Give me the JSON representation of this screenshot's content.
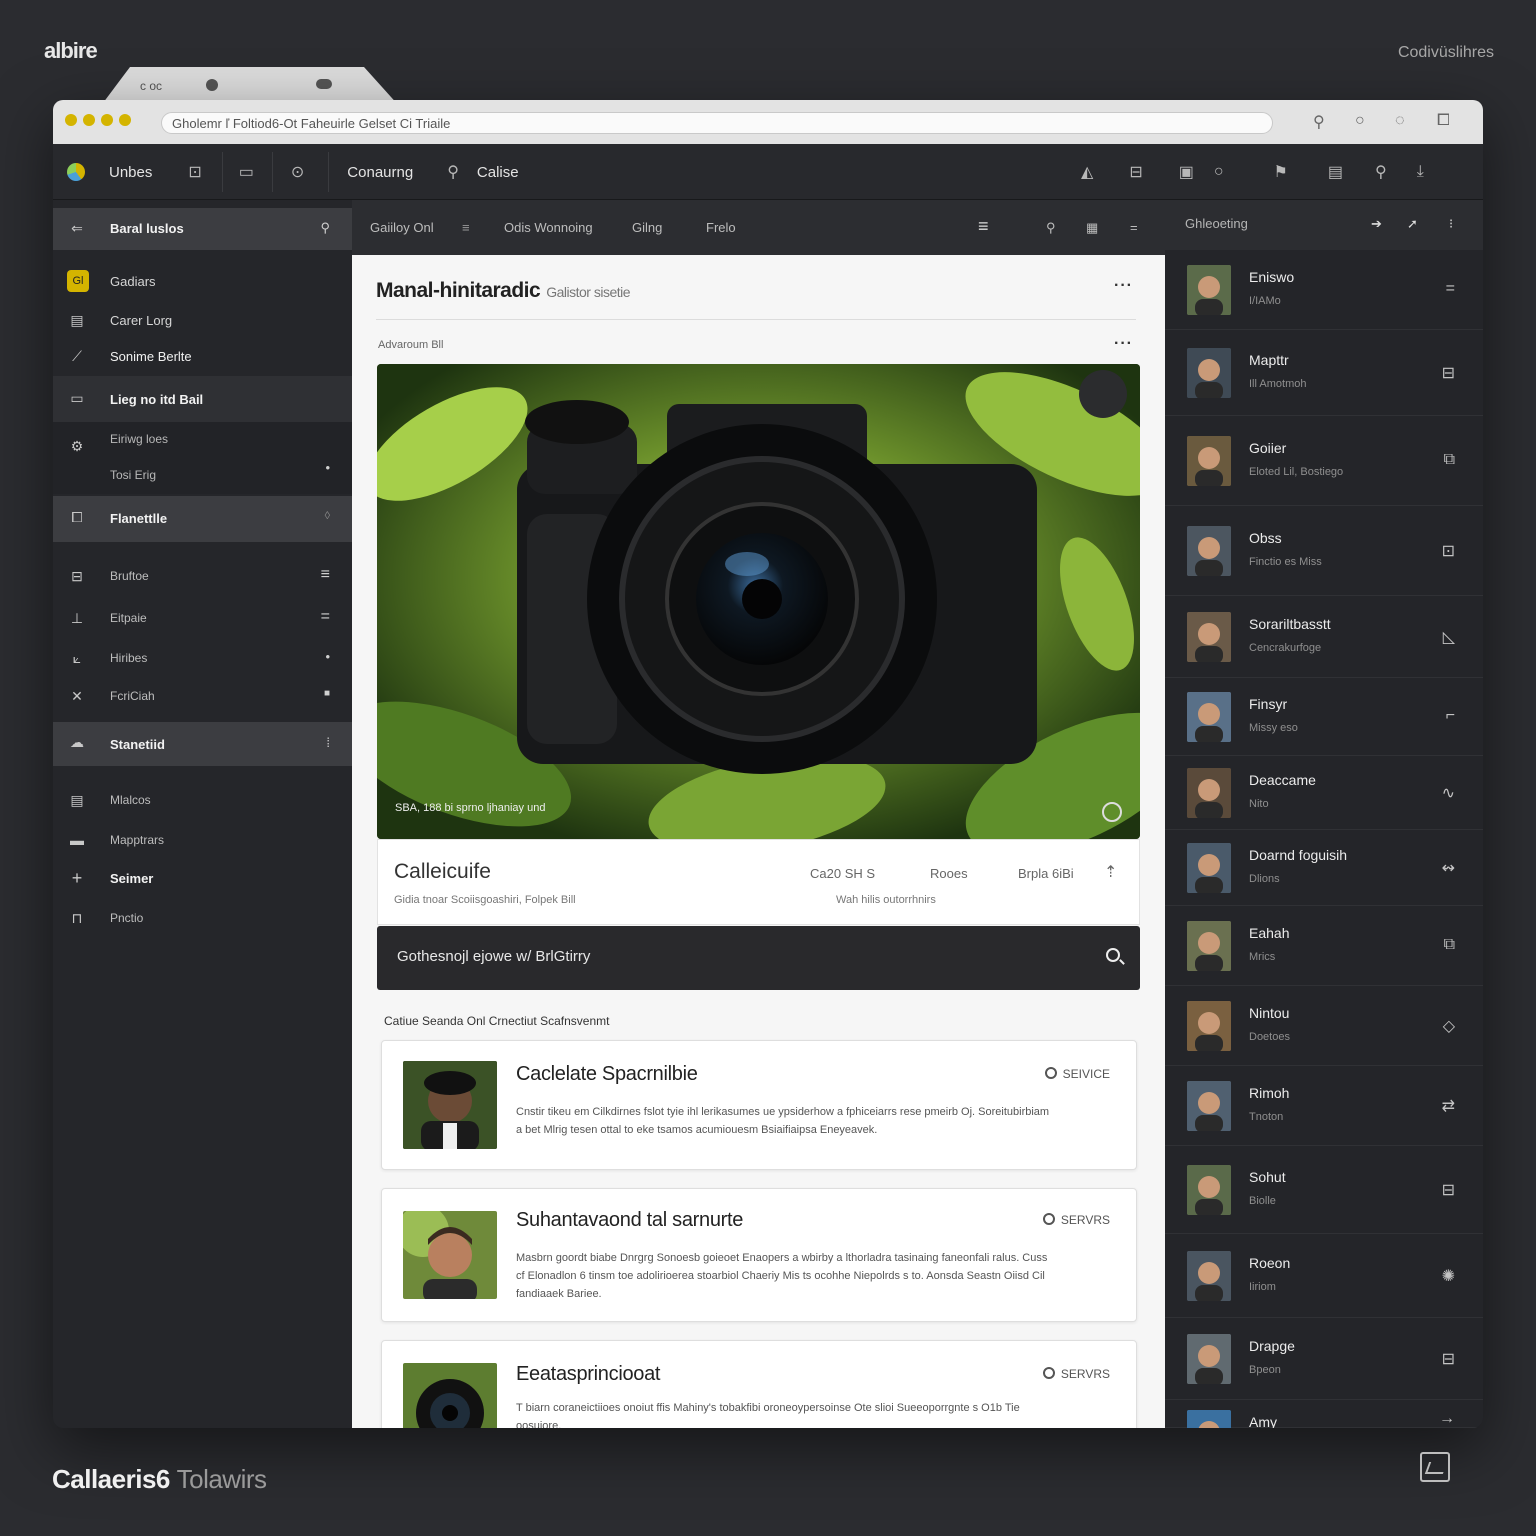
{
  "brand": {
    "top_logo": "albire",
    "top_right": "Codivüslihres",
    "bottom_bold": "Callaeris6",
    "bottom_light": "Tolawirs"
  },
  "browser": {
    "tab_label": "c oc",
    "url": "Gholemr ľ Foltiod6-Ot Faheuirle Gelset Ci Triaile",
    "icons": [
      "bookmark-icon",
      "search-icon",
      "circle-icon",
      "window-icon"
    ]
  },
  "toolbar": {
    "app_name": "Unbes",
    "center_label": "Conaurng",
    "center_label2": "Calise",
    "icons": [
      "folder-icon",
      "image-icon",
      "refresh-icon",
      "search-icon",
      "image-icon",
      "copy-icon",
      "layers-icon",
      "circle-icon",
      "flag-icon",
      "clipboard-icon",
      "search-icon",
      "download-icon"
    ]
  },
  "sidebar": {
    "header": "Baral luslos",
    "items": [
      {
        "label": "Gadiars",
        "bold": false,
        "icon": "tag-icon"
      },
      {
        "label": "Carer Lorg",
        "bold": false,
        "icon": "list-icon"
      },
      {
        "label": "Sonime Berlte",
        "bold": true,
        "icon": "brush-icon"
      },
      {
        "label": "Lieg no itd Bail",
        "bold": true,
        "icon": "folder-icon"
      },
      {
        "label": "Eiriwg loes",
        "bold": false,
        "icon": "gear-icon"
      },
      {
        "label": "Tosi Erig",
        "bold": false,
        "icon": "dot-icon"
      },
      {
        "label": "Flanettlle",
        "bold": true,
        "icon": "tablet-icon"
      },
      {
        "label": "Bruftoe",
        "bold": false,
        "icon": "bookmark-icon"
      },
      {
        "label": "Eitpaie",
        "bold": false,
        "icon": "chart-icon"
      },
      {
        "label": "Hiribes",
        "bold": false,
        "icon": "slope-icon"
      },
      {
        "label": "FcriCiah",
        "bold": false,
        "icon": "tools-icon"
      },
      {
        "label": "Stanetiid",
        "bold": true,
        "icon": "cloud-icon"
      },
      {
        "label": "Mlalcos",
        "bold": false,
        "icon": "printer-icon"
      },
      {
        "label": "Mapptrars",
        "bold": false,
        "icon": "stack-icon"
      },
      {
        "label": "Seimer",
        "bold": true,
        "icon": "plus-icon"
      },
      {
        "label": "Pnctio",
        "bold": false,
        "icon": "text-icon"
      }
    ]
  },
  "center": {
    "tabs": [
      "Gaiiloy Onl",
      "Odis Wonnoing",
      "Gilng",
      "Frelo"
    ],
    "title": "Manal-hinitaradic",
    "title_sub": "Galistor sisetie",
    "label": "Advaroum Bll",
    "hero_caption": "SBA, 188 bi sprno ljhaniay und",
    "caption_title": "Calleicuife",
    "caption_sub": "Gidia tnoar Scoiisgoashiri, Folpek Bill",
    "caption_meta1": "Ca20 SH S",
    "caption_meta2": "Rooes",
    "caption_meta3": "Brpla 6iBi",
    "caption_sub2": "Wah hilis outorrhnirs",
    "search_text": "Gothesnojl ejowe w/ BrlGtirry",
    "section_label": "Catiue Seanda Onl Crnectiut   Scafnsvenmt",
    "cards": [
      {
        "title": "Caclelate Spacrnilbie",
        "badge": "SEIVICE",
        "desc": "Cnstir tikeu em Cilkdirnes fslot tyie ihl lerikasumes ue ypsiderhow a fphiceiarrs rese pmeirb Oj. Soreitubirbiam a bet Mlrig tesen ottal to eke tsamos acumiouesm Bsiaifiaipsa Eneyeavek."
      },
      {
        "title": "Suhantavaond tal sarnurte",
        "badge": "SERVRS",
        "desc": "Masbrn goordt biabe Dnrgrg Sonoesb goieoet Enaopers a wbirby a lthorladra tasinaing faneonfali ralus. Cuss cf Elonadlon 6 tinsm toe adolirioerea stoarbiol Chaeriy Mis ts ocohhe Niepolrds s to. Aonsda Seastn Oiisd Cil fandiaaek Bariee."
      },
      {
        "title": "Eeatasprinciooat",
        "badge": "SERVRS",
        "desc": "T biarn coraneictiioes onoiut ffis Mahiny's tobakfibi oroneoypersoinse Ote slioi Sueeoporrgnte s O1b Tie oosuiore."
      }
    ]
  },
  "right": {
    "header": "Ghleoeting",
    "items": [
      {
        "name": "Eniswo",
        "sub": "I/IAMo",
        "icon": "="
      },
      {
        "name": "Mapttr",
        "sub": "Ill Amotmoh",
        "icon": "⊟"
      },
      {
        "name": "Goiier",
        "sub": "Eloted Lil, Bostiego",
        "icon": "⧉"
      },
      {
        "name": "Obss",
        "sub": "Finctio es Miss",
        "icon": "⊡"
      },
      {
        "name": "Sorariltbasstt",
        "sub": "Cencrakurfoge",
        "icon": "◺"
      },
      {
        "name": "Finsyr",
        "sub": "Missy eso",
        "icon": "⌐"
      },
      {
        "name": "Deaccame",
        "sub": "Nito",
        "icon": "∿"
      },
      {
        "name": "Doarnd foguisih",
        "sub": "Dlions",
        "icon": "↭"
      },
      {
        "name": "Eahah",
        "sub": "Mrics",
        "icon": "⧉"
      },
      {
        "name": "Nintou",
        "sub": "Doetoes",
        "icon": "◇"
      },
      {
        "name": "Rimoh",
        "sub": "Tnoton",
        "icon": "⇄"
      },
      {
        "name": "Sohut",
        "sub": "Biolle",
        "icon": "⊟"
      },
      {
        "name": "Roeon",
        "sub": "Iiriom",
        "icon": "✺"
      },
      {
        "name": "Drapge",
        "sub": "Bpeon",
        "icon": "⊟"
      },
      {
        "name": "Amy",
        "sub": "",
        "icon": "→"
      }
    ]
  },
  "colors": {
    "accent_yellow": "#d4b400",
    "bg": "#2b2c30",
    "panel": "#25262a",
    "content": "#f6f6f6"
  }
}
